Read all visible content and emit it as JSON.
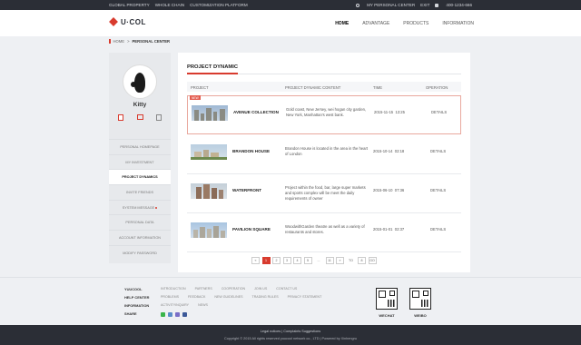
{
  "topbar": {
    "links": [
      "GLOBAL PROPERTY",
      "WHOLE CHAIN",
      "CUSTOMIZATION PLATFORM"
    ],
    "personal_center": "MY PERSONAL CENTER",
    "exit": "EXIT",
    "phone": "400-1234-666"
  },
  "header": {
    "logo": "U·COL",
    "nav": [
      "HOME",
      "ADVANTAGE",
      "PRODUCTS",
      "INFORMATION"
    ]
  },
  "breadcrumb": {
    "home": "HOME",
    "sep": ">",
    "current": "PERSONAL CENTER"
  },
  "sidebar": {
    "username": "Kitty",
    "menu": [
      "PERSONAL HOMEPAGE",
      "MY INVESTMENT",
      "PROJECT DYNAMICS",
      "INVITE FRIENDS",
      "SYSTEM MESSAGE",
      "PERSONAL DATA",
      "ACCOUNT INFORMATION",
      "MODIFY PASSWORD"
    ],
    "active_index": 2
  },
  "main": {
    "title": "PROJECT DYNAMIC",
    "columns": [
      "PROJECT",
      "PROJECT DYNAMIC CONTENT",
      "TIME",
      "OPERATION"
    ],
    "new_badge": "NEW",
    "rows": [
      {
        "name": "AVENUE COLLECTION",
        "content": "Gold coast, New Jersey, wei hogan city garden, New York, Manhattan's west bank.",
        "date": "2015-11-15",
        "clock": "13:25",
        "op": "DETAILS"
      },
      {
        "name": "BRANDON HOUSE",
        "content": "Brandon House is located in the area in the heart of London",
        "date": "2015-10-14",
        "clock": "02:18",
        "op": "DETAILS"
      },
      {
        "name": "WATERFRONT",
        "content": "Project within the food, bar, large super markets and sports complex will be meet the daily requirements of owner",
        "date": "2015-06-10",
        "clock": "07:36",
        "op": "DETAILS"
      },
      {
        "name": "PAVILION SQUARE",
        "content": "WoodwithGarden theatre as well as a variety of restaurants and stores.",
        "date": "2015-01-01",
        "clock": "02:37",
        "op": "DETAILS"
      }
    ],
    "pager": {
      "prev": "«",
      "pages": [
        "1",
        "2",
        "3",
        "4",
        "5",
        "...",
        "11"
      ],
      "next": "»",
      "to_label": "TO",
      "goto": "8",
      "go": "GO",
      "current": "1"
    }
  },
  "footer": {
    "rows": [
      {
        "label": "YUUCOOL",
        "links": [
          "INTRODUCTION",
          "PARTNERS",
          "COOPERATION",
          "JOIN US",
          "CONTACT US"
        ]
      },
      {
        "label": "HELP CENTER",
        "links": [
          "PROBLEMS",
          "FEEDBACK",
          "NEW GUIDELINES",
          "TRADING RULES",
          "PRIVACY STATEMENT"
        ]
      },
      {
        "label": "INFORMATION",
        "links": [
          "ACTIVITYINQUIRY",
          "NEWS"
        ]
      },
      {
        "label": "SHARE",
        "links": []
      }
    ],
    "share_colors": [
      "#3ab54a",
      "#5b8ec9",
      "#7a6fc7",
      "#3b5998"
    ],
    "qr_labels": [
      "WECHAT",
      "WEIBO"
    ],
    "legal": "Legal notices  |  Complaints Suggestions",
    "copyright": "Copyright © 2015   All rights reserved yuucool network co., LTD   |   Powered by Xinhengru"
  }
}
